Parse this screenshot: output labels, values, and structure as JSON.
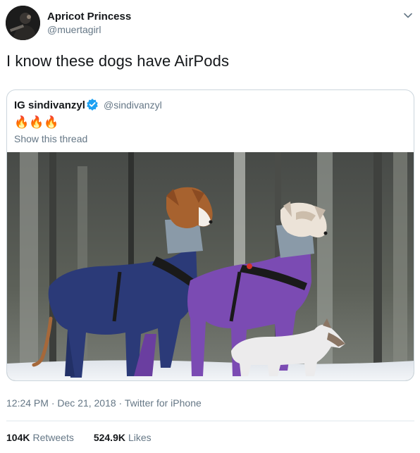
{
  "author": {
    "display_name": "Apricot Princess",
    "handle": "@muertagirl"
  },
  "tweet": {
    "text": "I know these dogs have AirPods"
  },
  "quoted_tweet": {
    "display_name": "IG sindivanzyl",
    "handle": "@sindivanzyl",
    "emoji": "🔥🔥🔥",
    "thread_link": "Show this thread",
    "image_subject": "two whippets and a small white dog in knitted sweaters on snow"
  },
  "meta": {
    "timestamp": "12:24 PM · Dec 21, 2018 · Twitter for iPhone"
  },
  "stats": {
    "retweets_count": "104K",
    "retweets_label": "Retweets",
    "likes_count": "524.9K",
    "likes_label": "Likes"
  },
  "icons": {
    "verified": "verified-badge-icon",
    "caret": "chevron-down-icon"
  },
  "colors": {
    "text_primary": "#14171a",
    "text_secondary": "#657786",
    "twitter_blue": "#1da1f2",
    "border": "#ccd6dd"
  }
}
